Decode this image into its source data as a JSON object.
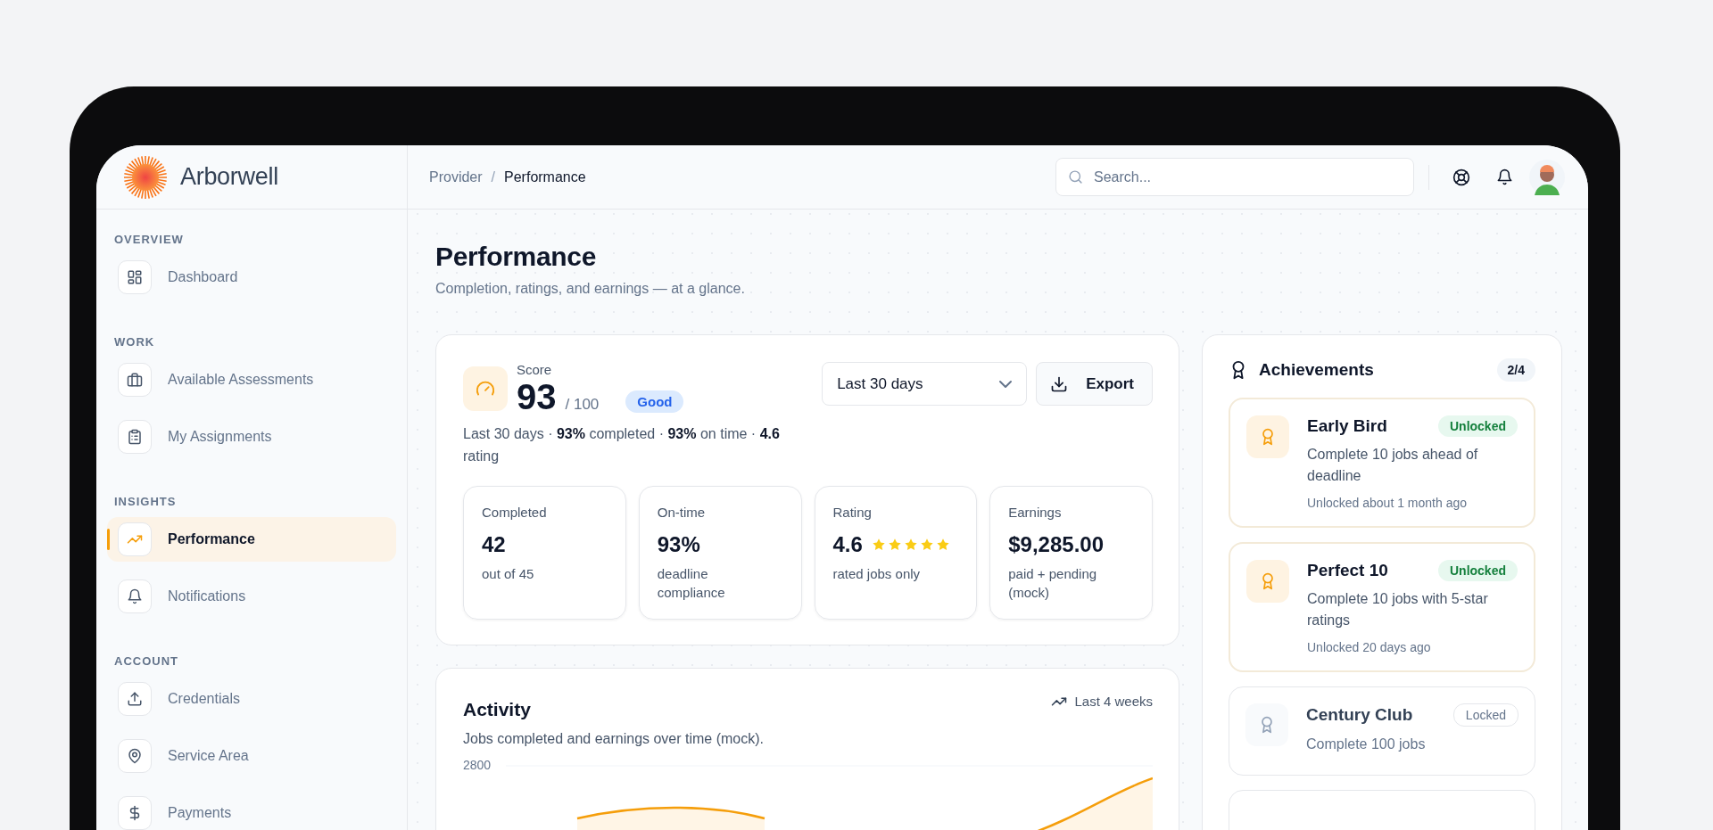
{
  "brand": {
    "name": "Arborwell"
  },
  "sidebar": {
    "sections": [
      {
        "label": "OVERVIEW",
        "items": [
          {
            "label": "Dashboard",
            "selected": false
          }
        ]
      },
      {
        "label": "WORK",
        "items": [
          {
            "label": "Available Assessments",
            "selected": false
          },
          {
            "label": "My Assignments",
            "selected": false
          }
        ]
      },
      {
        "label": "INSIGHTS",
        "items": [
          {
            "label": "Performance",
            "selected": true
          },
          {
            "label": "Notifications",
            "selected": false
          }
        ]
      },
      {
        "label": "ACCOUNT",
        "items": [
          {
            "label": "Credentials",
            "selected": false
          },
          {
            "label": "Service Area",
            "selected": false
          },
          {
            "label": "Payments",
            "selected": false
          }
        ]
      }
    ]
  },
  "header": {
    "breadcrumb": [
      "Provider",
      "Performance"
    ],
    "separator": "/",
    "search": {
      "placeholder": "Search..."
    }
  },
  "page": {
    "title": "Performance",
    "subtitle": "Completion, ratings, and earnings — at a glance."
  },
  "score": {
    "label": "Score",
    "value": "93",
    "max": "/ 100",
    "badge": "Good",
    "summary": "Last 30 days · **93%** completed · **93%** on time · **4.6** rating",
    "period": {
      "value": "Last 30 days"
    },
    "export": "Export",
    "stats": [
      {
        "label": "Completed",
        "value": "42",
        "note": "out of 45"
      },
      {
        "label": "On-time",
        "value": "93%",
        "note": "deadline compliance"
      },
      {
        "label": "Rating",
        "value": "4.6",
        "stars": 5,
        "note": "rated jobs only"
      },
      {
        "label": "Earnings",
        "value": "$9,285.00",
        "note": "paid + pending (mock)"
      }
    ]
  },
  "achievements": {
    "title": "Achievements",
    "count": "2/4",
    "items": [
      {
        "title": "Early Bird",
        "status": "Unlocked",
        "locked": false,
        "description": "Complete 10 jobs ahead of deadline",
        "when": "Unlocked about 1 month ago"
      },
      {
        "title": "Perfect 10",
        "status": "Unlocked",
        "locked": false,
        "description": "Complete 10 jobs with 5-star ratings",
        "when": "Unlocked 20 days ago"
      },
      {
        "title": "Century Club",
        "status": "Locked",
        "locked": true,
        "description": "Complete 100 jobs"
      },
      {
        "locked": true
      }
    ]
  },
  "activity": {
    "title": "Activity",
    "range": "Last 4 weeks",
    "subtitle": "Jobs completed and earnings over time (mock).",
    "y_tick_label": "2800"
  }
}
